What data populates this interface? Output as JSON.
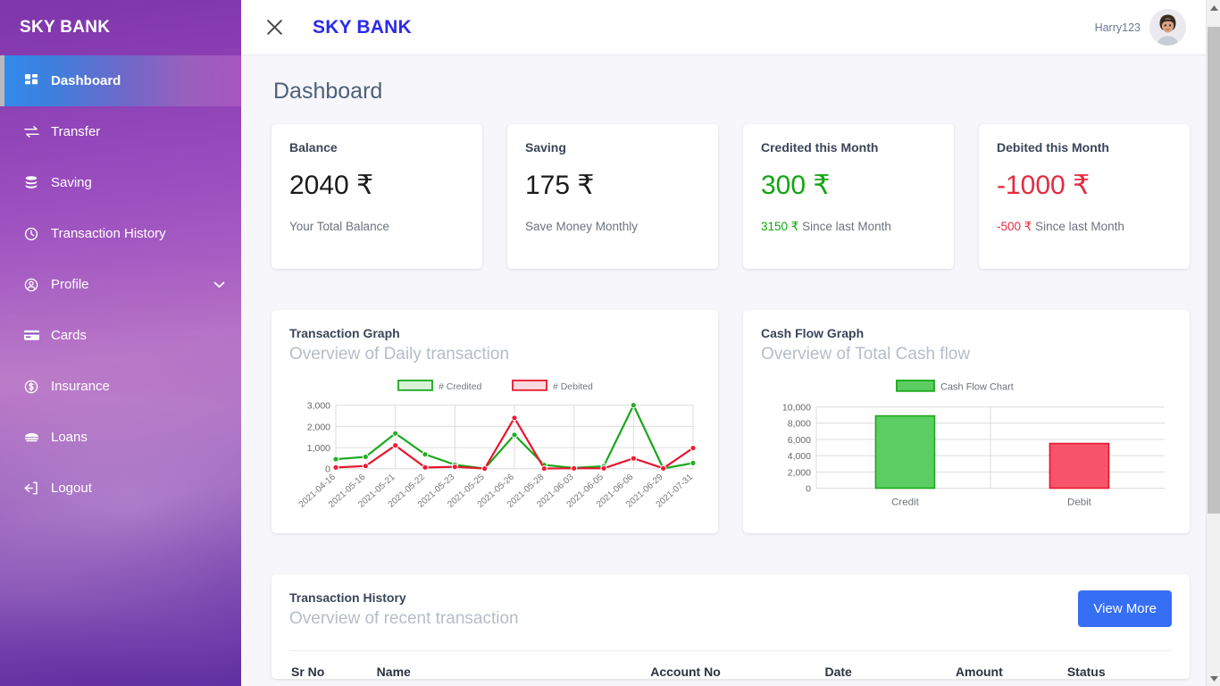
{
  "sidebar": {
    "brand": "SKY BANK",
    "items": [
      {
        "label": "Dashboard",
        "icon": "grid-icon",
        "active": true,
        "caret": false
      },
      {
        "label": "Transfer",
        "icon": "exchange-icon",
        "active": false,
        "caret": false
      },
      {
        "label": "Saving",
        "icon": "coins-icon",
        "active": false,
        "caret": false
      },
      {
        "label": "Transaction History",
        "icon": "clock-icon",
        "active": false,
        "caret": false
      },
      {
        "label": "Profile",
        "icon": "user-circle-icon",
        "active": false,
        "caret": true
      },
      {
        "label": "Cards",
        "icon": "credit-card-icon",
        "active": false,
        "caret": false
      },
      {
        "label": "Insurance",
        "icon": "dollar-circle-icon",
        "active": false,
        "caret": false
      },
      {
        "label": "Loans",
        "icon": "money-stack-icon",
        "active": false,
        "caret": false
      },
      {
        "label": "Logout",
        "icon": "logout-icon",
        "active": false,
        "caret": false
      }
    ]
  },
  "topbar": {
    "close_icon": "close-icon",
    "title": "SKY BANK",
    "user_name": "Harry123",
    "avatar_icon": "user-avatar"
  },
  "page": {
    "title": "Dashboard"
  },
  "stats": [
    {
      "label": "Balance",
      "value": "2040 ₹",
      "sub": "Your Total Balance",
      "tone": "neutral"
    },
    {
      "label": "Saving",
      "value": "175 ₹",
      "sub": "Save Money Monthly",
      "tone": "neutral"
    },
    {
      "label": "Credited this Month",
      "value": "300 ₹",
      "sub_amount": "3150 ₹",
      "sub_rest": "Since last Month",
      "tone": "green"
    },
    {
      "label": "Debited this Month",
      "value": "-1000 ₹",
      "sub_amount": "-500 ₹",
      "sub_rest": "Since last Month",
      "tone": "red"
    }
  ],
  "transaction_graph": {
    "title": "Transaction Graph",
    "subtitle": "Overview of Daily transaction"
  },
  "cash_flow_graph": {
    "title": "Cash Flow Graph",
    "subtitle": "Overview of Total Cash flow"
  },
  "history": {
    "title": "Transaction History",
    "subtitle": "Overview of recent transaction",
    "view_more_label": "View More",
    "columns": [
      "Sr No",
      "Name",
      "Account No",
      "Date",
      "Amount",
      "Status"
    ]
  },
  "colors": {
    "credit_green": "#19a81b",
    "debit_red": "#e8162d",
    "bar_green_fill": "#5ccd62",
    "bar_red_fill": "#f7546b",
    "accent_blue": "#366ef4",
    "brand_blue": "#2b2bea"
  },
  "chart_data": [
    {
      "type": "line",
      "title": "Transaction Graph",
      "subtitle": "Overview of Daily transaction",
      "xlabel": "",
      "ylabel": "",
      "ylim": [
        0,
        3000
      ],
      "yticks": [
        "0",
        "1,000",
        "2,000",
        "3,000"
      ],
      "grid": true,
      "legend_position": "top",
      "categories": [
        "2021-04-16",
        "2021-05-16",
        "2021-05-21",
        "2021-05-22",
        "2021-05-23",
        "2021-05-25",
        "2021-05-26",
        "2021-05-28",
        "2021-06-03",
        "2021-06-05",
        "2021-06-06",
        "2021-06-29",
        "2021-07-31"
      ],
      "series": [
        {
          "name": "# Credited",
          "color": "#19a81b",
          "values": [
            450,
            560,
            1670,
            680,
            190,
            10,
            1600,
            180,
            40,
            120,
            3000,
            10,
            270
          ]
        },
        {
          "name": "# Debited",
          "color": "#e8162d",
          "values": [
            60,
            130,
            1100,
            60,
            90,
            10,
            2400,
            10,
            20,
            20,
            490,
            20,
            980
          ]
        }
      ]
    },
    {
      "type": "bar",
      "title": "Cash Flow Graph",
      "subtitle": "Overview of Total Cash flow",
      "xlabel": "",
      "ylabel": "",
      "ylim": [
        0,
        10000
      ],
      "yticks": [
        "0",
        "2,000",
        "4,000",
        "6,000",
        "8,000",
        "10,000"
      ],
      "grid": true,
      "legend_position": "top",
      "legend": [
        "Cash Flow Chart"
      ],
      "categories": [
        "Credit",
        "Debit"
      ],
      "values": [
        8900,
        5500
      ],
      "bar_colors": [
        "#5ccd62",
        "#f7546b"
      ]
    }
  ],
  "scrollbar": {
    "up_icon": "scroll-up-arrow",
    "down_icon": "scroll-down-arrow",
    "thumb": "scrollbar-thumb"
  }
}
